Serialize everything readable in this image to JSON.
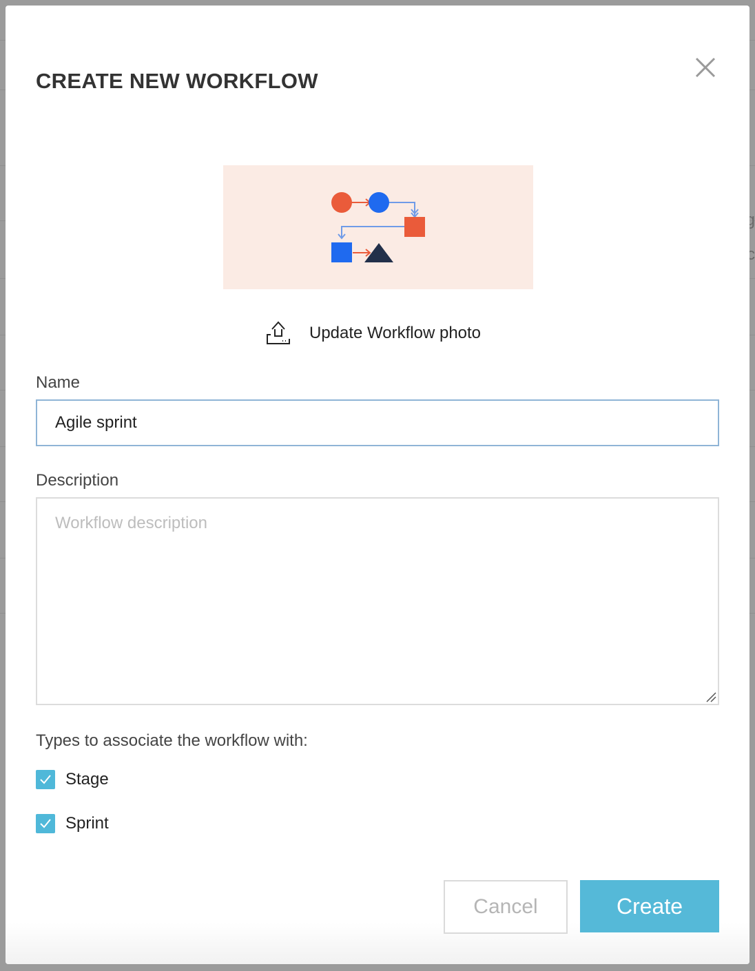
{
  "dialog": {
    "title": "CREATE NEW WORKFLOW",
    "close_icon": "close-icon"
  },
  "photo": {
    "background_color": "#fbebe4",
    "upload_icon": "upload-icon",
    "upload_label": "Update Workflow photo"
  },
  "form": {
    "name_label": "Name",
    "name_value": "Agile sprint",
    "description_label": "Description",
    "description_value": "",
    "description_placeholder": "Workflow description",
    "types_heading": "Types to associate the workflow with:",
    "types": [
      {
        "label": "Stage",
        "checked": true
      },
      {
        "label": "Sprint",
        "checked": true
      }
    ]
  },
  "actions": {
    "cancel_label": "Cancel",
    "create_label": "Create"
  },
  "colors": {
    "accent": "#55b9d8",
    "checkbox": "#4fb8d9",
    "input_focus_border": "#8fb4d6",
    "node_orange": "#ea5b3a",
    "node_blue": "#1f6aef",
    "node_navy": "#22304a"
  }
}
